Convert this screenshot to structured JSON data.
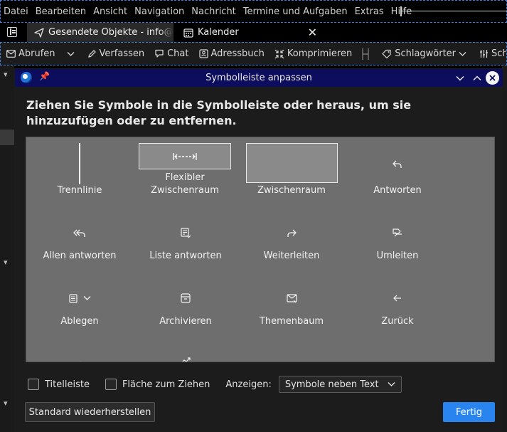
{
  "menubar": {
    "items": [
      "Datei",
      "Bearbeiten",
      "Ansicht",
      "Navigation",
      "Nachricht",
      "Termine und Aufgaben",
      "Extras",
      "Hilfe"
    ]
  },
  "tabs": [
    {
      "label": "Gesendete Objekte - info@",
      "icon": "send-icon",
      "active": true
    },
    {
      "label": "Kalender",
      "icon": "calendar-icon",
      "active": false
    }
  ],
  "toolbar": {
    "get_messages": "Abrufen",
    "compose": "Verfassen",
    "chat": "Chat",
    "address_book": "Adressbuch",
    "compact": "Komprimieren",
    "tags": "Schlagwörter",
    "quick_filter": "Schnell"
  },
  "dialog": {
    "title": "Symbolleiste anpassen",
    "instruction": "Ziehen Sie Symbole in die Symbolleiste oder heraus, um sie hinzuzufügen oder zu entfernen.",
    "palette": {
      "separator": "Trennlinie",
      "flexible_space": "Flexibler Zwischenraum",
      "space": "Zwischenraum",
      "reply": "Antworten",
      "reply_all": "Allen antworten",
      "reply_list": "Liste antworten",
      "forward": "Weiterleiten",
      "redirect": "Umleiten",
      "file": "Ablegen",
      "archive": "Archivieren",
      "thread_tree": "Themenbaum",
      "back": "Zurück"
    },
    "options": {
      "title_bar": "Titelleiste",
      "drag_space": "Fläche zum Ziehen",
      "show_label": "Anzeigen:",
      "show_value": "Symbole neben Text"
    },
    "restore_default": "Standard wiederherstellen",
    "done": "Fertig"
  },
  "colors": {
    "dialog_title_bg": "#0d0d5e",
    "palette_bg": "#6e6e6e",
    "primary_button": "#2a84f0",
    "customize_outline": "#3d7ed6"
  }
}
